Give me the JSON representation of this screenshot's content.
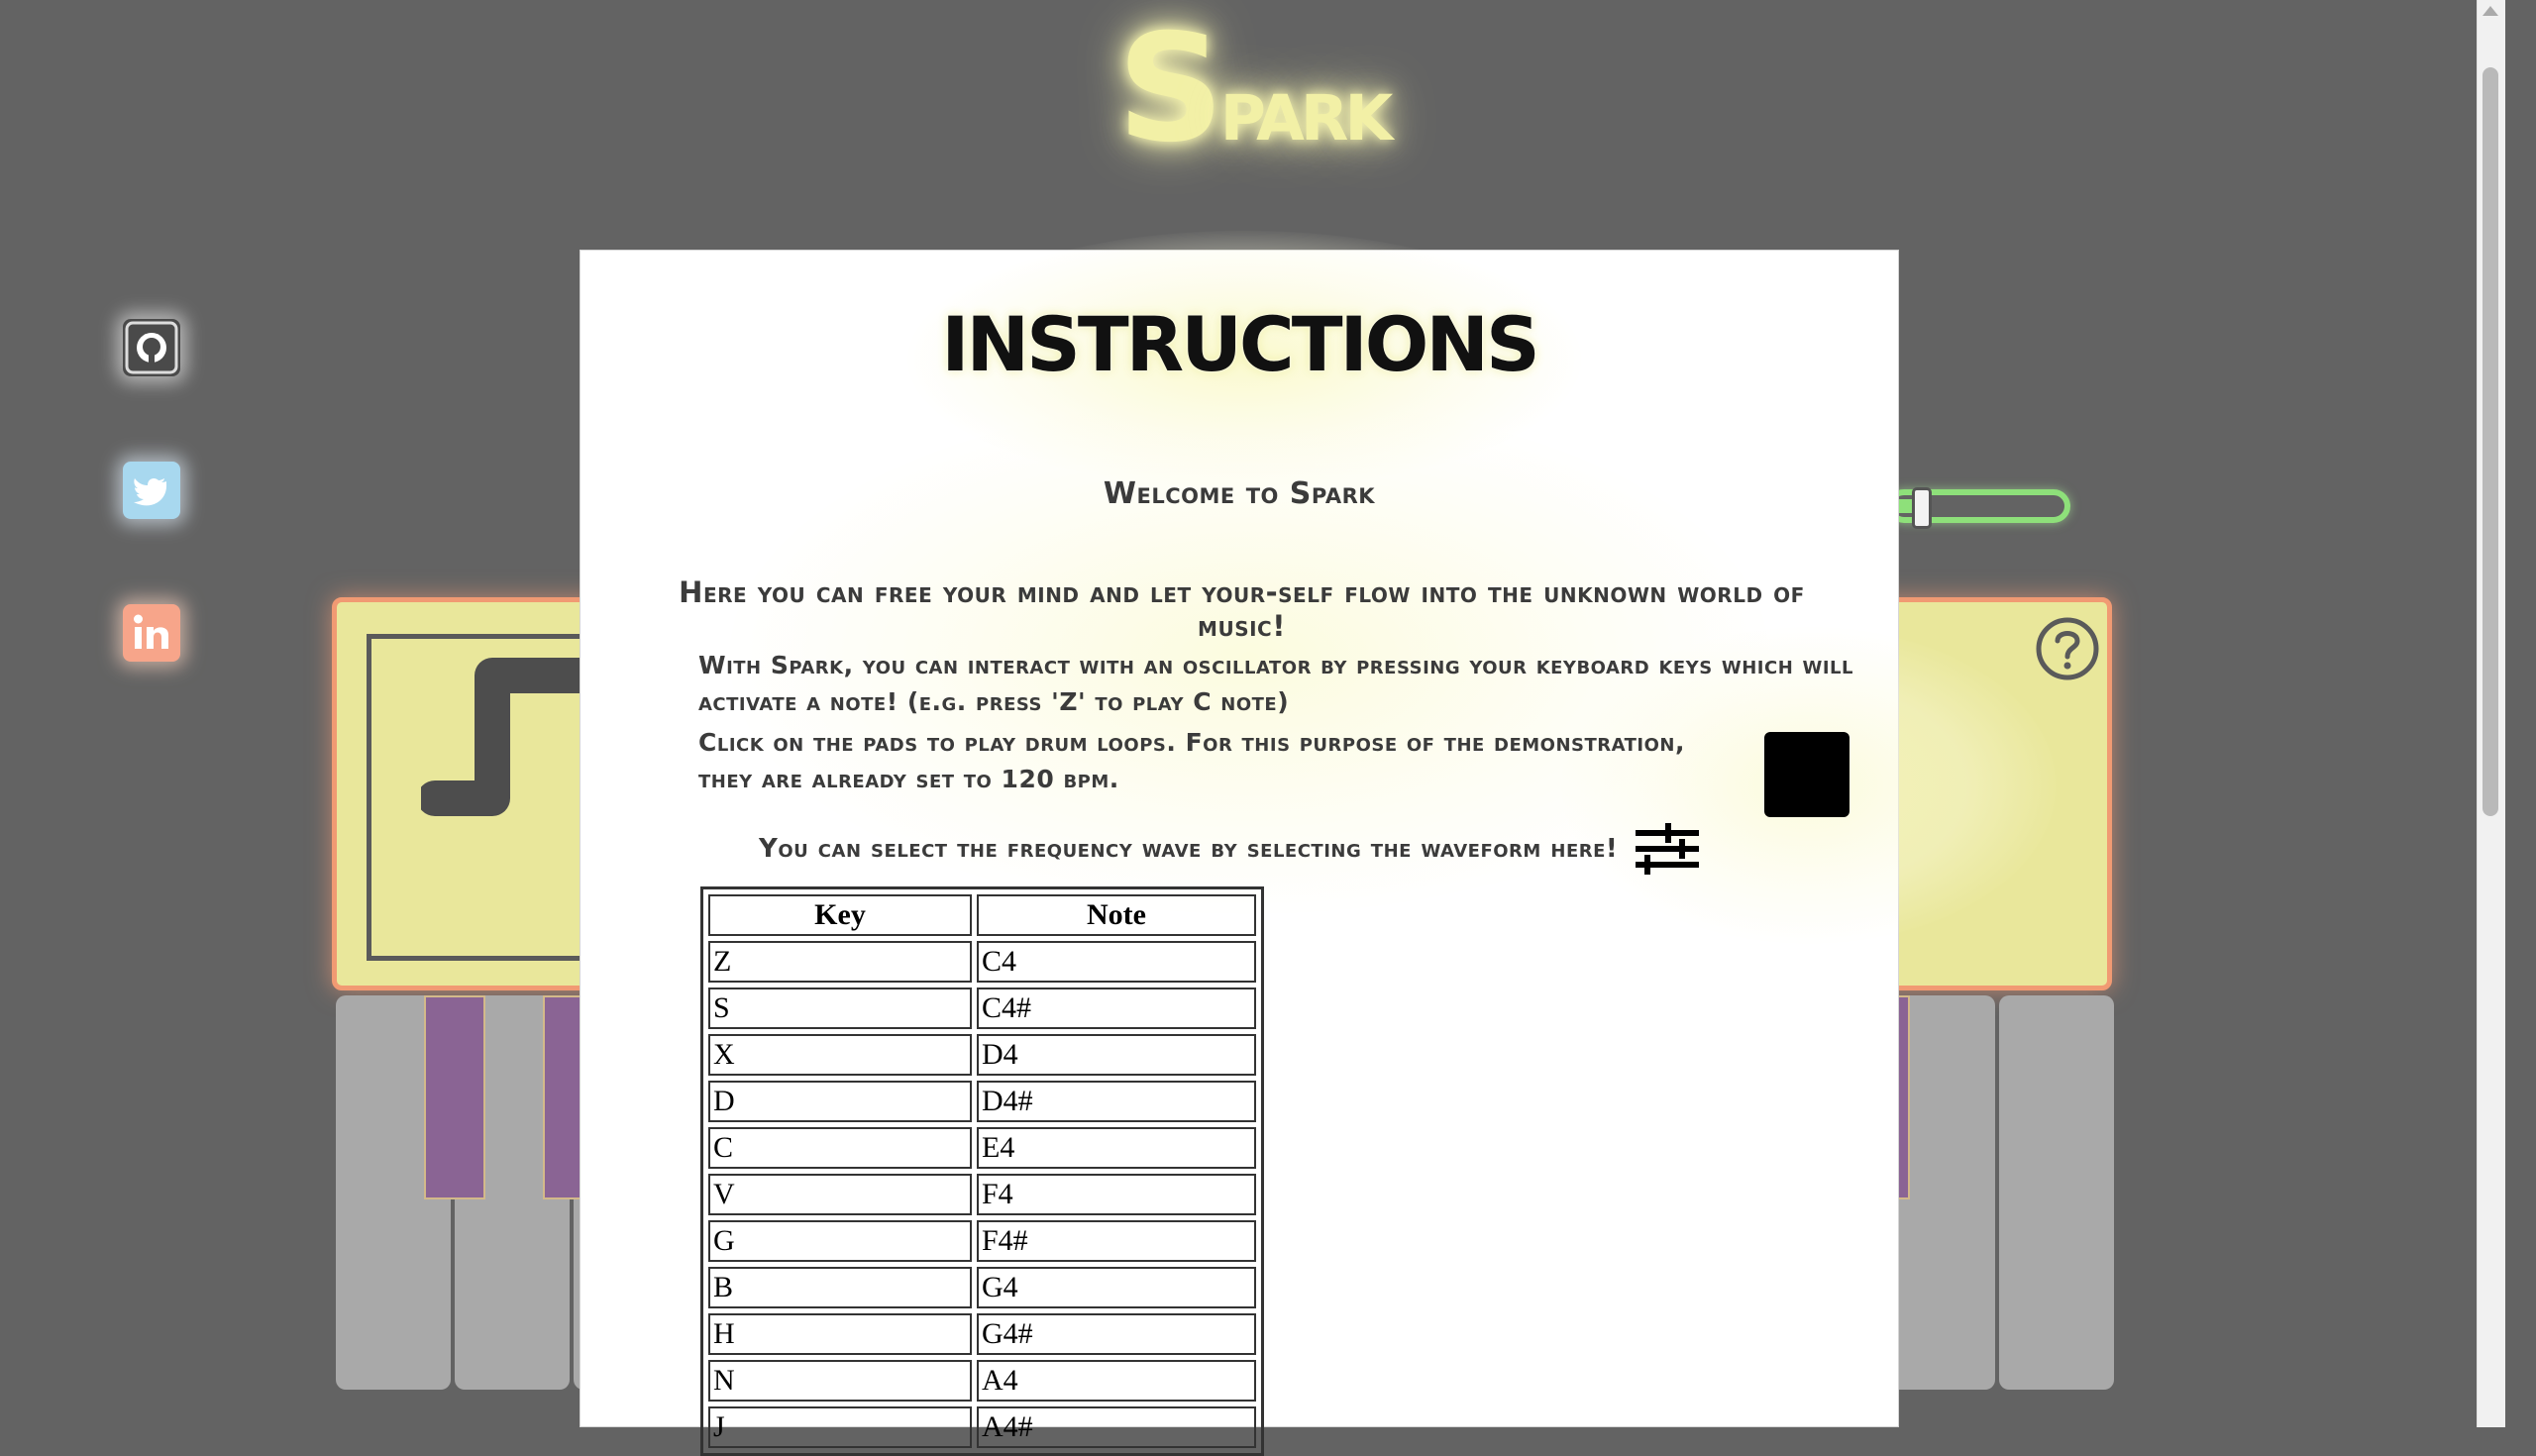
{
  "app": {
    "logo_first": "S",
    "logo_rest": "park"
  },
  "social": [
    {
      "name": "github",
      "icon": "github-icon"
    },
    {
      "name": "twitter",
      "icon": "twitter-icon"
    },
    {
      "name": "linkedin",
      "icon": "linkedin-icon"
    }
  ],
  "colors": {
    "background": "#636363",
    "panel": "#e9e79b",
    "panel_border": "#f19a73",
    "slider": "#8ee07a",
    "black_key": "#8a6494",
    "white_key": "#a9a9a9"
  },
  "modal": {
    "title": "INSTRUCTIONS",
    "welcome": "Welcome to Spark",
    "intro": "Here you can free your mind and let your-self flow into the unknown world of music!",
    "oscillator": "With Spark, you can interact with an oscillator by pressing your keyboard keys which will activate a note! (e.g. press 'Z' to play C note)",
    "drums": "Click on the pads to play drum loops. For this purpose of the demonstration, they are already set to 120 bpm.",
    "waveform": "You can select the frequency wave by selecting the waveform here!",
    "table": {
      "headers": [
        "Key",
        "Note"
      ],
      "rows": [
        [
          "Z",
          "C4"
        ],
        [
          "S",
          "C4#"
        ],
        [
          "X",
          "D4"
        ],
        [
          "D",
          "D4#"
        ],
        [
          "C",
          "E4"
        ],
        [
          "V",
          "F4"
        ],
        [
          "G",
          "F4#"
        ],
        [
          "B",
          "G4"
        ],
        [
          "H",
          "G4#"
        ],
        [
          "N",
          "A4"
        ],
        [
          "J",
          "A4#"
        ]
      ]
    }
  },
  "icons": {
    "help": "question-circle-icon",
    "waveform_select": "sliders-icon",
    "stop": "stop-square-icon",
    "wave_display": "square-wave-icon"
  }
}
